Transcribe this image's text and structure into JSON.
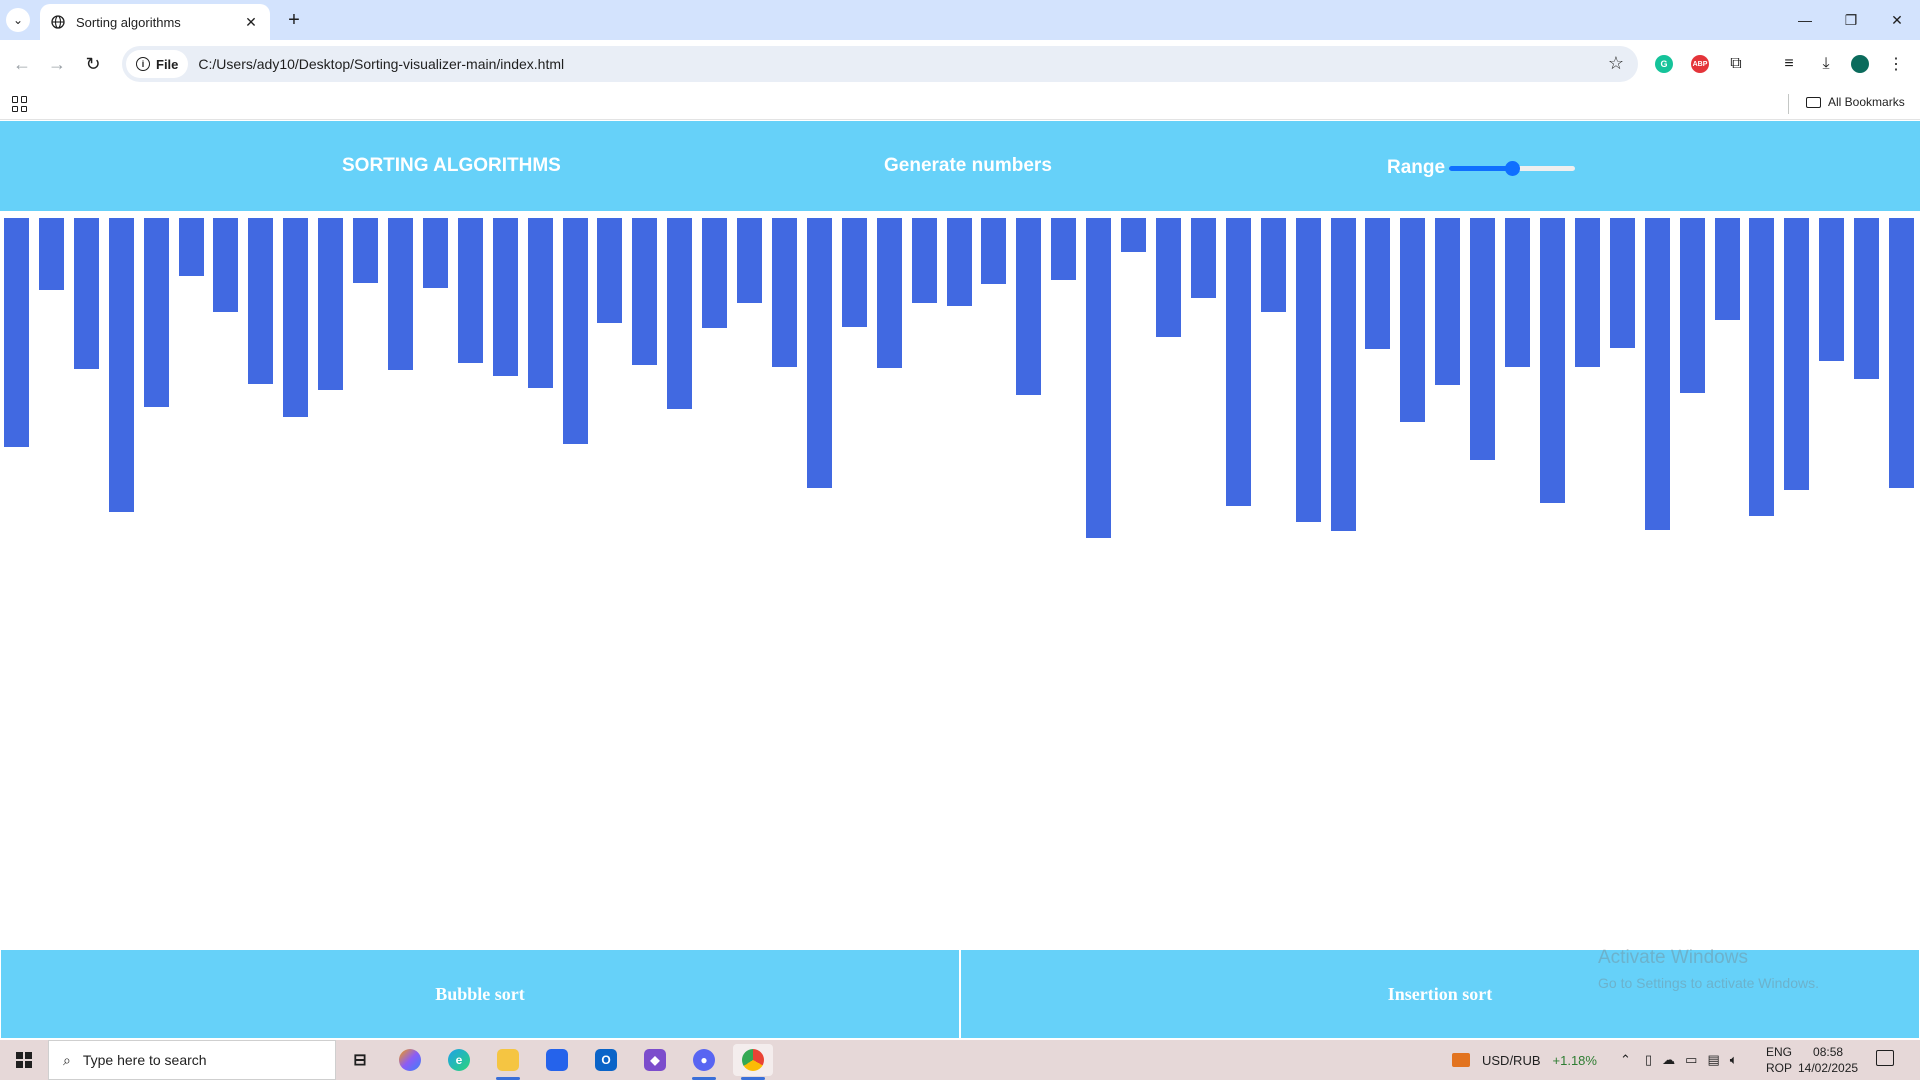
{
  "browser": {
    "tab_title": "Sorting algorithms",
    "site_chip_label": "File",
    "url": "C:/Users/ady10/Desktop/Sorting-visualizer-main/index.html",
    "all_bookmarks_label": "All Bookmarks",
    "extension_abp": "ABP"
  },
  "nav": {
    "title": "SORTING ALGORITHMS",
    "generate_label": "Generate numbers",
    "range_label": "Range",
    "range_slider_value": 0.5
  },
  "bars": {
    "color": "#4169e1",
    "values": [
      229,
      72,
      151,
      294,
      189,
      58,
      94,
      166,
      199,
      172,
      65,
      152,
      70,
      145,
      158,
      170,
      226,
      105,
      147,
      191,
      110,
      85,
      149,
      270,
      109,
      150,
      85,
      88,
      66,
      177,
      62,
      320,
      34,
      119,
      80,
      288,
      94,
      304,
      313,
      131,
      204,
      167,
      242,
      149,
      285,
      149,
      130,
      312,
      175,
      102,
      298,
      272,
      143,
      161,
      270
    ]
  },
  "buttons": {
    "bubble_sort": "Bubble sort",
    "insertion_sort": "Insertion sort"
  },
  "watermark": {
    "line1": "Activate Windows",
    "line2": "Go to Settings to activate Windows."
  },
  "taskbar": {
    "search_placeholder": "Type here to search",
    "ticker_label": "USD/RUB",
    "ticker_change": "+1.18%",
    "lang_line1": "ENG",
    "lang_line2": "ROP",
    "time": "08:58",
    "date": "14/02/2025"
  },
  "colors": {
    "nav_bg": "#66d1f9",
    "bar": "#4169e1",
    "slider": "#0f6fff"
  }
}
